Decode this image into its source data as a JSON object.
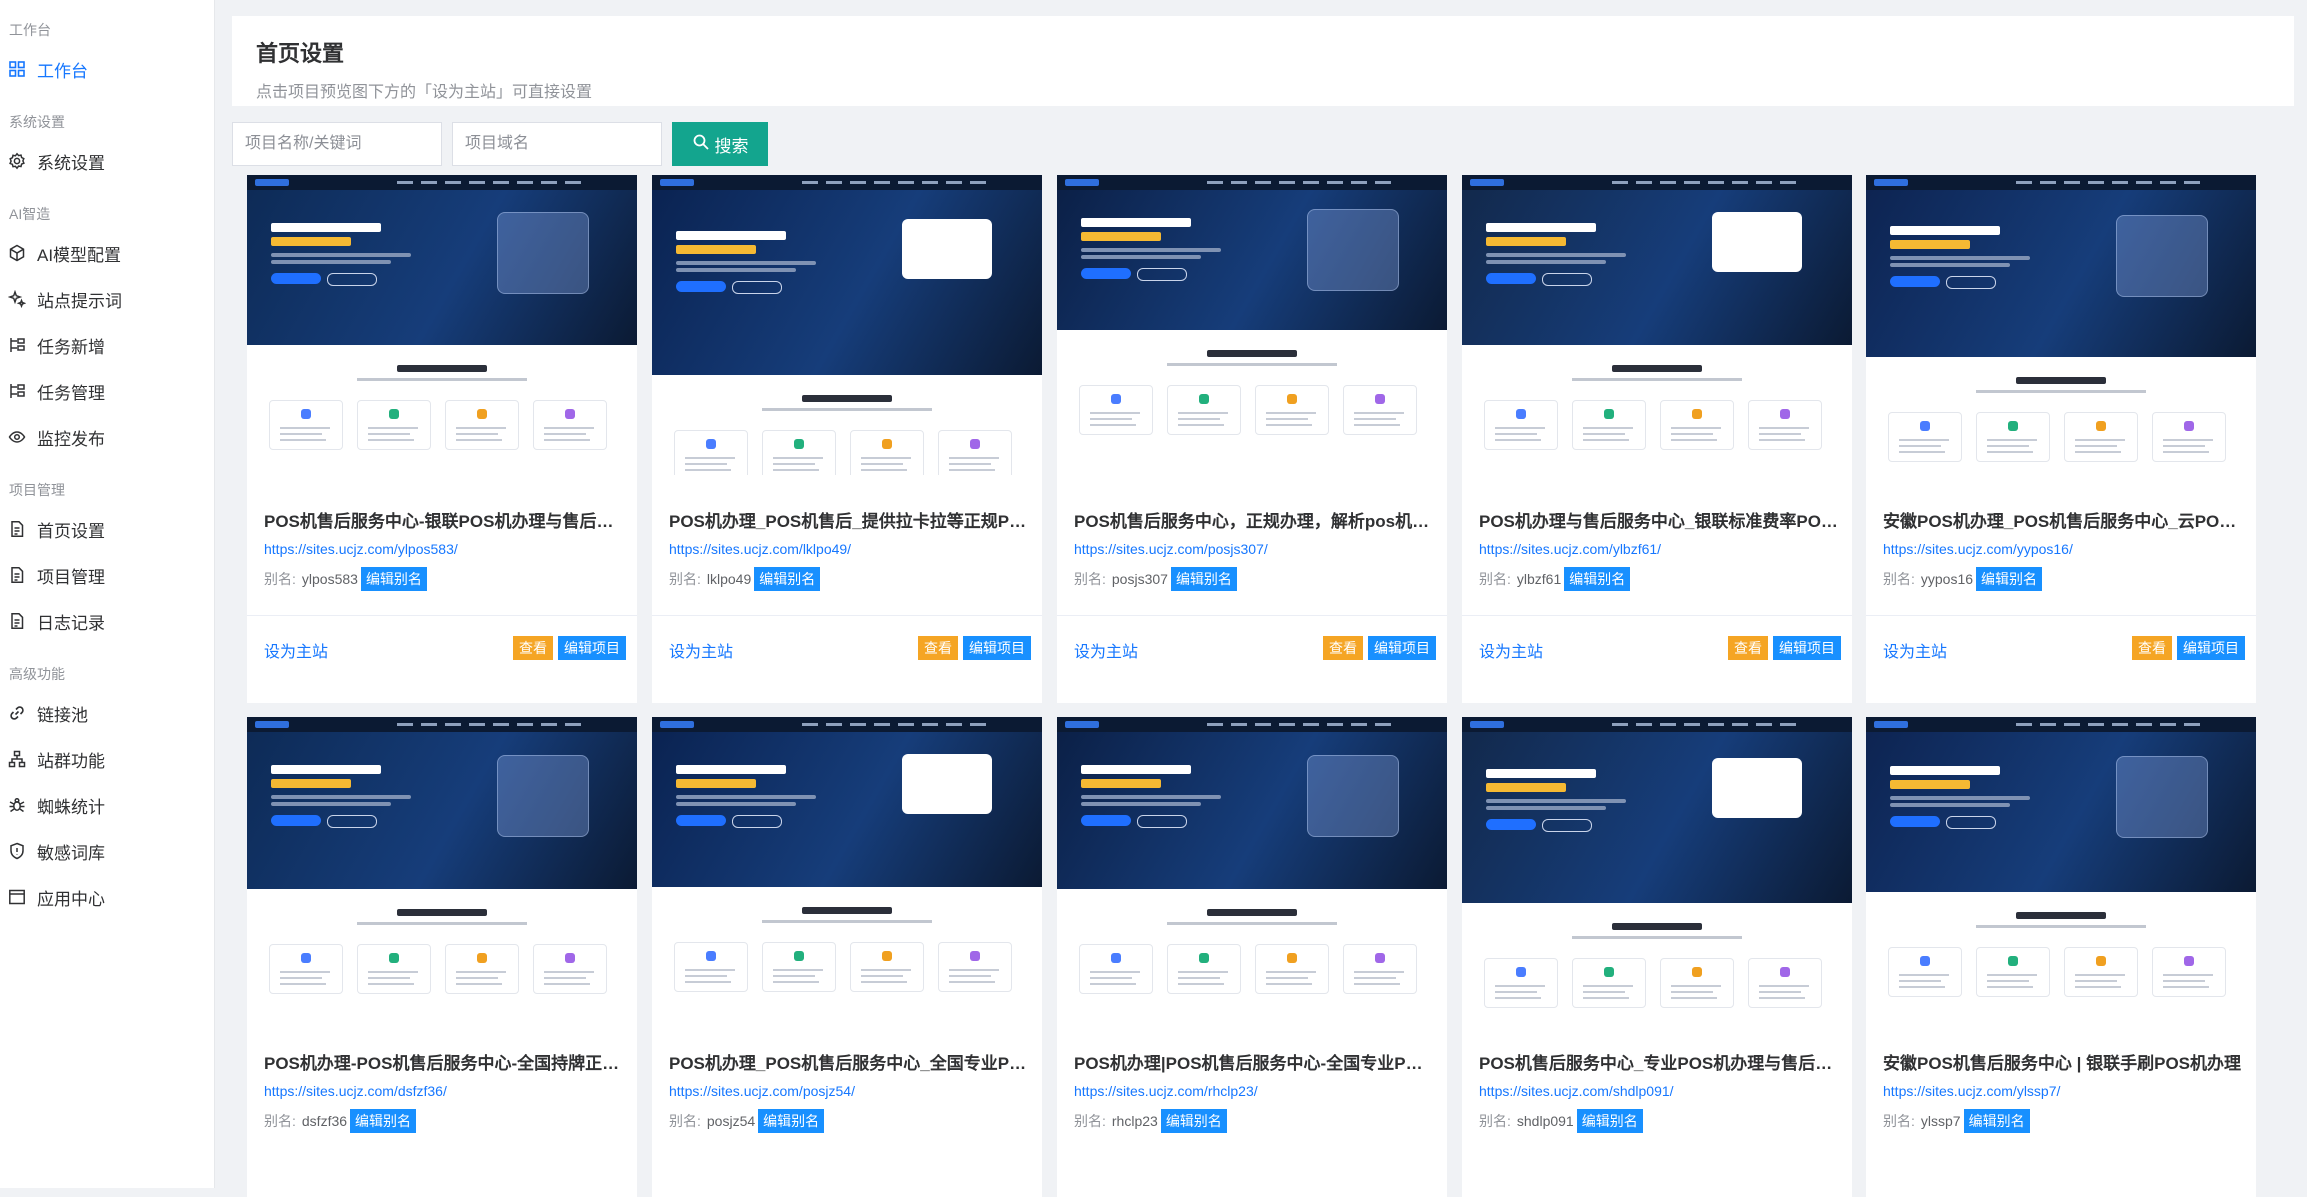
{
  "sidebar": {
    "groups": [
      {
        "title": "工作台",
        "items": [
          {
            "label": "工作台",
            "icon": "grid-icon",
            "active": true
          }
        ]
      },
      {
        "title": "系统设置",
        "items": [
          {
            "label": "系统设置",
            "icon": "gear-icon"
          }
        ]
      },
      {
        "title": "AI智造",
        "items": [
          {
            "label": "AI模型配置",
            "icon": "cube-icon"
          },
          {
            "label": "站点提示词",
            "icon": "sparkle-icon"
          },
          {
            "label": "任务新增",
            "icon": "task-add-icon"
          },
          {
            "label": "任务管理",
            "icon": "task-manage-icon"
          },
          {
            "label": "监控发布",
            "icon": "eye-icon"
          }
        ]
      },
      {
        "title": "项目管理",
        "items": [
          {
            "label": "首页设置",
            "icon": "document-icon"
          },
          {
            "label": "项目管理",
            "icon": "document-icon"
          },
          {
            "label": "日志记录",
            "icon": "document-icon"
          }
        ]
      },
      {
        "title": "高级功能",
        "items": [
          {
            "label": "链接池",
            "icon": "link-icon"
          },
          {
            "label": "站群功能",
            "icon": "network-icon"
          },
          {
            "label": "蜘蛛统计",
            "icon": "spider-icon"
          },
          {
            "label": "敏感词库",
            "icon": "shield-icon"
          },
          {
            "label": "应用中心",
            "icon": "app-window-icon"
          }
        ]
      }
    ]
  },
  "header": {
    "title": "首页设置",
    "description": "点击项目预览图下方的「设为主站」可直接设置"
  },
  "search": {
    "name_placeholder": "项目名称/关键词",
    "domain_placeholder": "项目域名",
    "button_label": "搜索"
  },
  "card_labels": {
    "alias_label": "别名:",
    "edit_alias": "编辑别名",
    "set_main": "设为主站",
    "view": "查看",
    "edit_project": "编辑项目"
  },
  "colors": {
    "accent": "#1677ff",
    "search_button": "#13a58e",
    "view_button": "#f5a524",
    "tag_button": "#1890ff"
  },
  "projects": [
    {
      "title": "POS机售后服务中心-银联POS机办理与售后维护一站式平台",
      "url": "https://sites.ucjz.com/ylpos583/",
      "alias": "ylpos583"
    },
    {
      "title": "POS机办理_POS机售后_提供拉卡拉等正规POS机办理服务",
      "url": "https://sites.ucjz.com/lklpo49/",
      "alias": "lklpo49"
    },
    {
      "title": "POS机售后服务中心，正规办理，解析pos机常见问题",
      "url": "https://sites.ucjz.com/posjs307/",
      "alias": "posjs307"
    },
    {
      "title": "POS机办理与售后服务中心_银联标准费率POS机",
      "url": "https://sites.ucjz.com/ylbzf61/",
      "alias": "ylbzf61"
    },
    {
      "title": "安徽POS机办理_POS机售后服务中心_云POS机办理",
      "url": "https://sites.ucjz.com/yypos16/",
      "alias": "yypos16"
    },
    {
      "title": "POS机办理-POS机售后服务中心-全国持牌正规POS机",
      "url": "https://sites.ucjz.com/dsfzf36/",
      "alias": "dsfzf36"
    },
    {
      "title": "POS机办理_POS机售后服务中心_全国专业POS机服务",
      "url": "https://sites.ucjz.com/posjz54/",
      "alias": "posjz54"
    },
    {
      "title": "POS机办理|POS机售后服务中心-全国专业POS机办理",
      "url": "https://sites.ucjz.com/rhclp23/",
      "alias": "rhclp23"
    },
    {
      "title": "POS机售后服务中心_专业POS机办理与售后维修",
      "url": "https://sites.ucjz.com/shdlp091/",
      "alias": "shdlp091"
    },
    {
      "title": "安徽POS机售后服务中心 | 银联手刷POS机办理",
      "url": "https://sites.ucjz.com/ylssp7/",
      "alias": "ylssp7"
    }
  ]
}
